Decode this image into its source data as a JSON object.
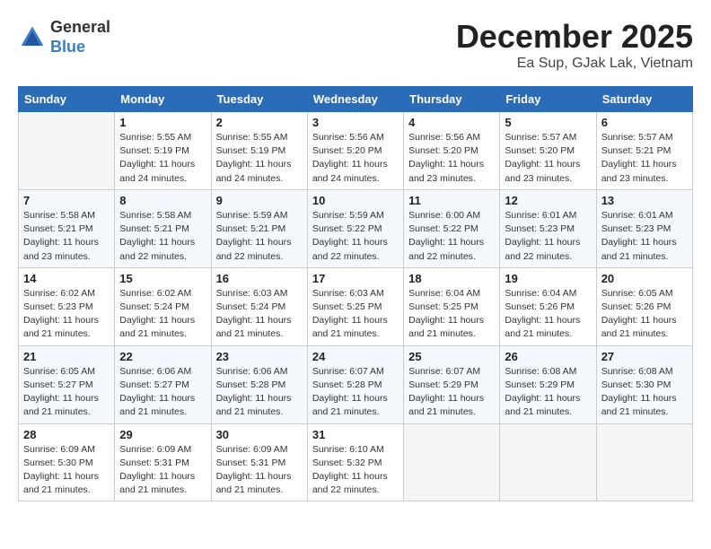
{
  "header": {
    "logo": {
      "general": "General",
      "blue": "Blue"
    },
    "title": "December 2025",
    "subtitle": "Ea Sup, GJak Lak, Vietnam"
  },
  "calendar": {
    "days": [
      "Sunday",
      "Monday",
      "Tuesday",
      "Wednesday",
      "Thursday",
      "Friday",
      "Saturday"
    ],
    "weeks": [
      [
        {
          "date": "",
          "info": ""
        },
        {
          "date": "1",
          "info": "Sunrise: 5:55 AM\nSunset: 5:19 PM\nDaylight: 11 hours\nand 24 minutes."
        },
        {
          "date": "2",
          "info": "Sunrise: 5:55 AM\nSunset: 5:19 PM\nDaylight: 11 hours\nand 24 minutes."
        },
        {
          "date": "3",
          "info": "Sunrise: 5:56 AM\nSunset: 5:20 PM\nDaylight: 11 hours\nand 24 minutes."
        },
        {
          "date": "4",
          "info": "Sunrise: 5:56 AM\nSunset: 5:20 PM\nDaylight: 11 hours\nand 23 minutes."
        },
        {
          "date": "5",
          "info": "Sunrise: 5:57 AM\nSunset: 5:20 PM\nDaylight: 11 hours\nand 23 minutes."
        },
        {
          "date": "6",
          "info": "Sunrise: 5:57 AM\nSunset: 5:21 PM\nDaylight: 11 hours\nand 23 minutes."
        }
      ],
      [
        {
          "date": "7",
          "info": "Sunrise: 5:58 AM\nSunset: 5:21 PM\nDaylight: 11 hours\nand 23 minutes."
        },
        {
          "date": "8",
          "info": "Sunrise: 5:58 AM\nSunset: 5:21 PM\nDaylight: 11 hours\nand 22 minutes."
        },
        {
          "date": "9",
          "info": "Sunrise: 5:59 AM\nSunset: 5:21 PM\nDaylight: 11 hours\nand 22 minutes."
        },
        {
          "date": "10",
          "info": "Sunrise: 5:59 AM\nSunset: 5:22 PM\nDaylight: 11 hours\nand 22 minutes."
        },
        {
          "date": "11",
          "info": "Sunrise: 6:00 AM\nSunset: 5:22 PM\nDaylight: 11 hours\nand 22 minutes."
        },
        {
          "date": "12",
          "info": "Sunrise: 6:01 AM\nSunset: 5:23 PM\nDaylight: 11 hours\nand 22 minutes."
        },
        {
          "date": "13",
          "info": "Sunrise: 6:01 AM\nSunset: 5:23 PM\nDaylight: 11 hours\nand 21 minutes."
        }
      ],
      [
        {
          "date": "14",
          "info": "Sunrise: 6:02 AM\nSunset: 5:23 PM\nDaylight: 11 hours\nand 21 minutes."
        },
        {
          "date": "15",
          "info": "Sunrise: 6:02 AM\nSunset: 5:24 PM\nDaylight: 11 hours\nand 21 minutes."
        },
        {
          "date": "16",
          "info": "Sunrise: 6:03 AM\nSunset: 5:24 PM\nDaylight: 11 hours\nand 21 minutes."
        },
        {
          "date": "17",
          "info": "Sunrise: 6:03 AM\nSunset: 5:25 PM\nDaylight: 11 hours\nand 21 minutes."
        },
        {
          "date": "18",
          "info": "Sunrise: 6:04 AM\nSunset: 5:25 PM\nDaylight: 11 hours\nand 21 minutes."
        },
        {
          "date": "19",
          "info": "Sunrise: 6:04 AM\nSunset: 5:26 PM\nDaylight: 11 hours\nand 21 minutes."
        },
        {
          "date": "20",
          "info": "Sunrise: 6:05 AM\nSunset: 5:26 PM\nDaylight: 11 hours\nand 21 minutes."
        }
      ],
      [
        {
          "date": "21",
          "info": "Sunrise: 6:05 AM\nSunset: 5:27 PM\nDaylight: 11 hours\nand 21 minutes."
        },
        {
          "date": "22",
          "info": "Sunrise: 6:06 AM\nSunset: 5:27 PM\nDaylight: 11 hours\nand 21 minutes."
        },
        {
          "date": "23",
          "info": "Sunrise: 6:06 AM\nSunset: 5:28 PM\nDaylight: 11 hours\nand 21 minutes."
        },
        {
          "date": "24",
          "info": "Sunrise: 6:07 AM\nSunset: 5:28 PM\nDaylight: 11 hours\nand 21 minutes."
        },
        {
          "date": "25",
          "info": "Sunrise: 6:07 AM\nSunset: 5:29 PM\nDaylight: 11 hours\nand 21 minutes."
        },
        {
          "date": "26",
          "info": "Sunrise: 6:08 AM\nSunset: 5:29 PM\nDaylight: 11 hours\nand 21 minutes."
        },
        {
          "date": "27",
          "info": "Sunrise: 6:08 AM\nSunset: 5:30 PM\nDaylight: 11 hours\nand 21 minutes."
        }
      ],
      [
        {
          "date": "28",
          "info": "Sunrise: 6:09 AM\nSunset: 5:30 PM\nDaylight: 11 hours\nand 21 minutes."
        },
        {
          "date": "29",
          "info": "Sunrise: 6:09 AM\nSunset: 5:31 PM\nDaylight: 11 hours\nand 21 minutes."
        },
        {
          "date": "30",
          "info": "Sunrise: 6:09 AM\nSunset: 5:31 PM\nDaylight: 11 hours\nand 21 minutes."
        },
        {
          "date": "31",
          "info": "Sunrise: 6:10 AM\nSunset: 5:32 PM\nDaylight: 11 hours\nand 22 minutes."
        },
        {
          "date": "",
          "info": ""
        },
        {
          "date": "",
          "info": ""
        },
        {
          "date": "",
          "info": ""
        }
      ]
    ]
  }
}
